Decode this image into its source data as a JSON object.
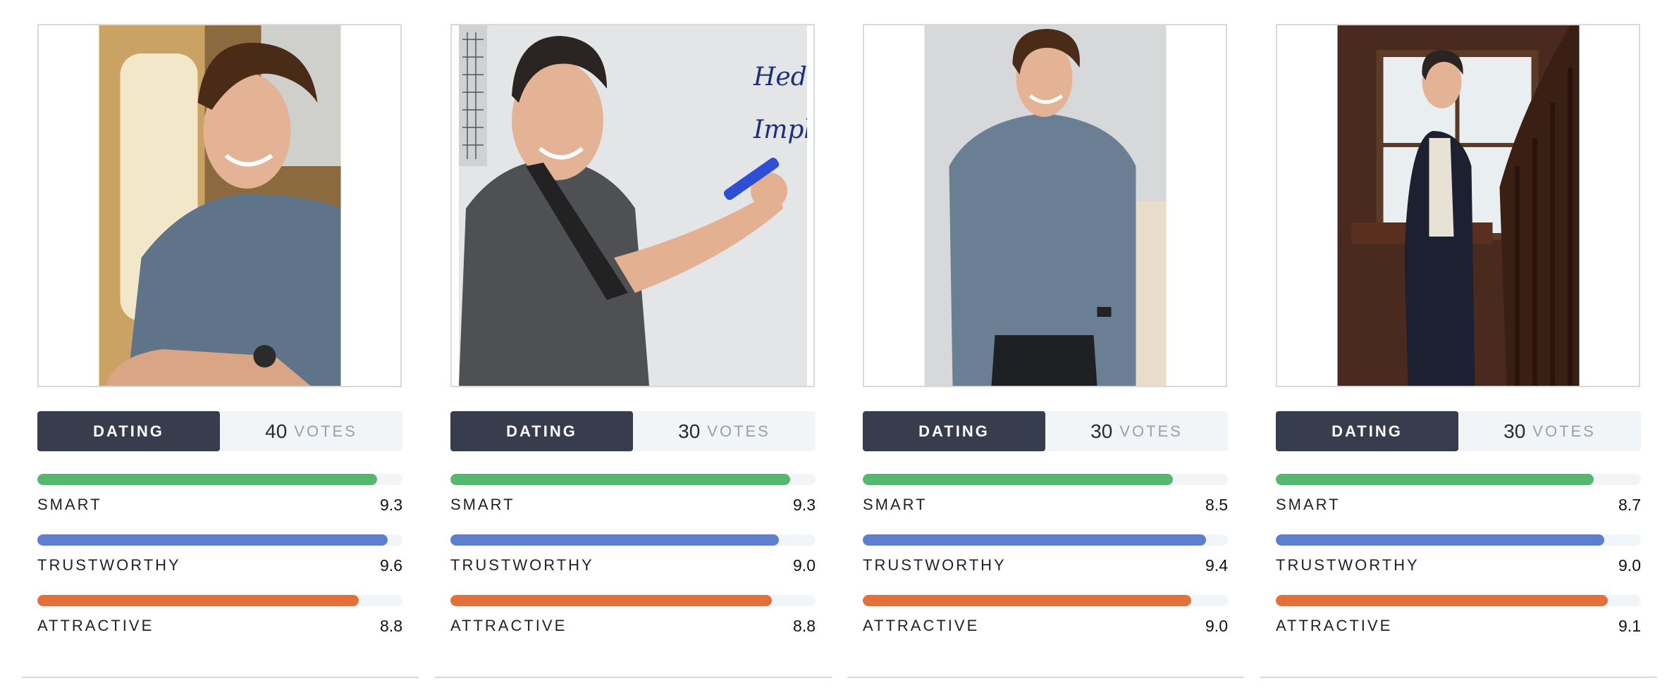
{
  "colors": {
    "smart": "#56b76f",
    "trustworthy": "#5c7fd0",
    "attractive": "#e3703a",
    "tag_bg": "#373d4c"
  },
  "max_score": 10,
  "cards": [
    {
      "photo": "photo-man-smiling-seated-gray-shirt",
      "category": "DATING",
      "votes_count": "40",
      "votes_label": "VOTES",
      "metrics": [
        {
          "label": "SMART",
          "score": "9.3",
          "value": 9.3
        },
        {
          "label": "TRUSTWORTHY",
          "score": "9.6",
          "value": 9.6
        },
        {
          "label": "ATTRACTIVE",
          "score": "8.8",
          "value": 8.8
        }
      ]
    },
    {
      "photo": "photo-man-writing-on-whiteboard",
      "category": "DATING",
      "votes_count": "30",
      "votes_label": "VOTES",
      "whiteboard_text": [
        "Hedon",
        "Impli"
      ],
      "metrics": [
        {
          "label": "SMART",
          "score": "9.3",
          "value": 9.3
        },
        {
          "label": "TRUSTWORTHY",
          "score": "9.0",
          "value": 9.0
        },
        {
          "label": "ATTRACTIVE",
          "score": "8.8",
          "value": 8.8
        }
      ]
    },
    {
      "photo": "photo-man-standing-gray-shirt",
      "category": "DATING",
      "votes_count": "30",
      "votes_label": "VOTES",
      "metrics": [
        {
          "label": "SMART",
          "score": "8.5",
          "value": 8.5
        },
        {
          "label": "TRUSTWORTHY",
          "score": "9.4",
          "value": 9.4
        },
        {
          "label": "ATTRACTIVE",
          "score": "9.0",
          "value": 9.0
        }
      ]
    },
    {
      "photo": "photo-man-blazer-staircase",
      "category": "DATING",
      "votes_count": "30",
      "votes_label": "VOTES",
      "metrics": [
        {
          "label": "SMART",
          "score": "8.7",
          "value": 8.7
        },
        {
          "label": "TRUSTWORTHY",
          "score": "9.0",
          "value": 9.0
        },
        {
          "label": "ATTRACTIVE",
          "score": "9.1",
          "value": 9.1
        }
      ]
    }
  ]
}
